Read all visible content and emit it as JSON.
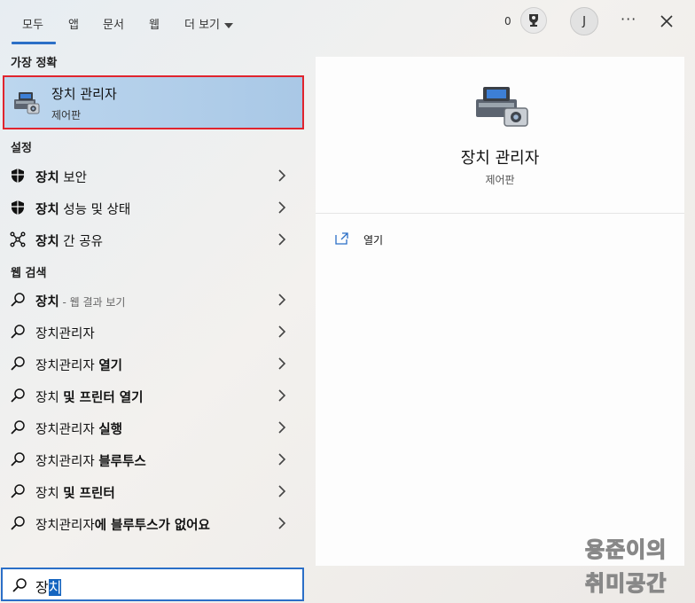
{
  "tabs": {
    "all": "모두",
    "apps": "앱",
    "docs": "문서",
    "web": "웹",
    "more": "더 보기"
  },
  "account": {
    "points": "0",
    "avatar_letter": "J"
  },
  "best_match": {
    "heading": "가장 정확",
    "title": "장치 관리자",
    "subtitle": "제어판"
  },
  "settings": {
    "heading": "설정",
    "items": [
      {
        "bold": "장치",
        "rest": " 보안"
      },
      {
        "bold": "장치",
        "rest": " 성능 및 상태"
      },
      {
        "bold": "장치",
        "rest": " 간 공유"
      }
    ]
  },
  "web": {
    "heading": "웹 검색",
    "items": [
      {
        "bold": "장치",
        "rest": "",
        "muted": " - 웹 결과 보기"
      },
      {
        "bold": "",
        "rest": "장치관리자",
        "muted": ""
      },
      {
        "bold": "",
        "rest": "장치관리자 ",
        "tail": "열기",
        "muted": ""
      },
      {
        "bold": "",
        "rest": "장치 ",
        "tail": "및 프린터 열기",
        "muted": ""
      },
      {
        "bold": "",
        "rest": "장치관리자 ",
        "tail": "실행",
        "muted": ""
      },
      {
        "bold": "",
        "rest": "장치관리자 ",
        "tail": "블루투스",
        "muted": ""
      },
      {
        "bold": "",
        "rest": "장치 ",
        "tail": "및 프린터",
        "muted": ""
      },
      {
        "bold": "",
        "rest": "장치관리자",
        "tail": "에 블루투스가 없어요",
        "muted": ""
      }
    ]
  },
  "detail": {
    "title": "장치 관리자",
    "subtitle": "제어판",
    "open_label": "열기"
  },
  "search": {
    "typed": "장",
    "selected": "치"
  },
  "watermark": {
    "line1": "용준이의",
    "line2": "취미공간"
  },
  "colors": {
    "accent": "#2b6fc7",
    "highlight_border": "#e0242e",
    "selection": "#1565c0"
  }
}
